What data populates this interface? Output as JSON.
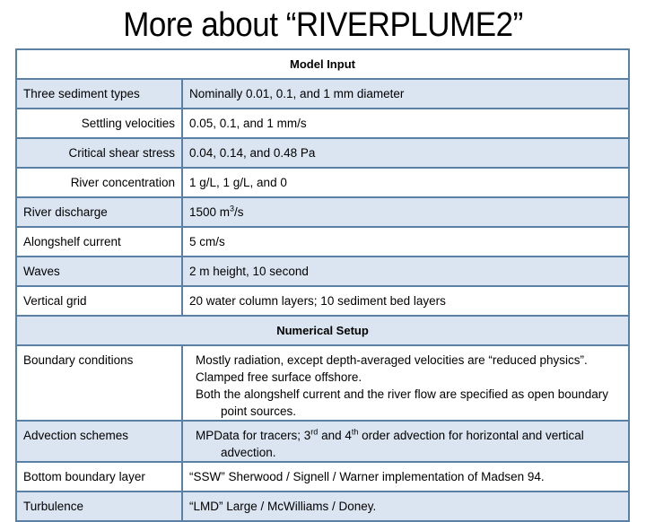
{
  "title": "More about “RIVERPLUME2”",
  "sections": {
    "model_input": "Model Input",
    "numerical_setup": "Numerical Setup"
  },
  "model_input_rows": [
    {
      "label": "Three sediment types",
      "value": "Nominally 0.01, 0.1, and 1 mm diameter"
    },
    {
      "label": "Settling velocities",
      "value": "0.05, 0.1, and 1 mm/s"
    },
    {
      "label": "Critical shear stress",
      "value": "0.04, 0.14, and 0.48 Pa"
    },
    {
      "label": "River concentration",
      "value": "1 g/L, 1 g/L, and 0"
    },
    {
      "label": "River discharge",
      "value_prefix": "1500 m",
      "value_sup": "3",
      "value_suffix": "/s"
    },
    {
      "label": "Alongshelf current",
      "value": "5 cm/s"
    },
    {
      "label": "Waves",
      "value": "2 m height, 10 second"
    },
    {
      "label": "Vertical grid",
      "value": "20 water column layers; 10 sediment bed layers"
    }
  ],
  "numerical_rows": [
    {
      "label": "Boundary conditions",
      "lines": [
        "Mostly radiation, except depth-averaged velocities are “reduced physics”.",
        "Clamped free surface offshore.",
        "Both the alongshelf current and the river flow are specified as open boundary point sources."
      ]
    },
    {
      "label": "Advection schemes",
      "parts": [
        "MPData for tracers; 3",
        "rd",
        " and 4",
        "th",
        " order advection for horizontal and vertical advection."
      ]
    },
    {
      "label": "Bottom boundary layer",
      "value": "“SSW” Sherwood / Signell / Warner implementation of Madsen 94."
    },
    {
      "label": "Turbulence",
      "value": "“LMD” Large / McWilliams / Doney."
    }
  ]
}
